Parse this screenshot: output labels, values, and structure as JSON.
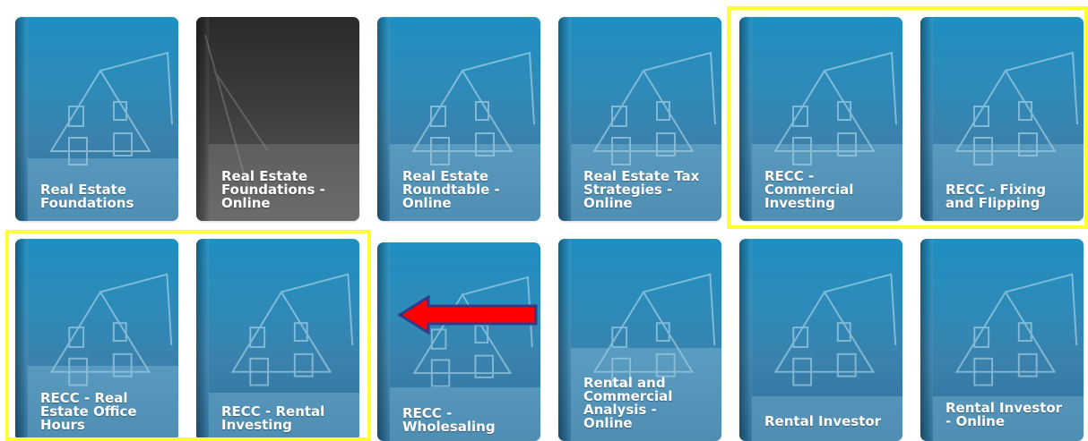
{
  "courses": [
    {
      "title": "Real Estate\nFoundations",
      "style": "blue"
    },
    {
      "title": "Real Estate\nFoundations -\nOnline",
      "style": "dark"
    },
    {
      "title": "Real Estate\nRoundtable -\nOnline",
      "style": "blue"
    },
    {
      "title": "Real Estate Tax\nStrategies -\nOnline",
      "style": "blue"
    },
    {
      "title": "RECC -\nCommercial\nInvesting",
      "style": "blue"
    },
    {
      "title": "RECC - Fixing\nand Flipping",
      "style": "blue"
    },
    {
      "title": "RECC - Real\nEstate Office\nHours",
      "style": "blue"
    },
    {
      "title": "RECC - Rental\nInvesting",
      "style": "blue"
    },
    {
      "title": "RECC -\nWholesaling",
      "style": "blue"
    },
    {
      "title": "Rental and\nCommercial\nAnalysis -\nOnline",
      "style": "blue"
    },
    {
      "title": "Rental Investor",
      "style": "blue"
    },
    {
      "title": "Rental Investor\n- Online",
      "style": "blue"
    }
  ],
  "colors": {
    "highlight": "#ffff33",
    "arrow": "#ff0000",
    "arrow_outline": "#2f3a8a"
  },
  "icons": {
    "house": "house-illustration",
    "arrow": "left-arrow"
  }
}
